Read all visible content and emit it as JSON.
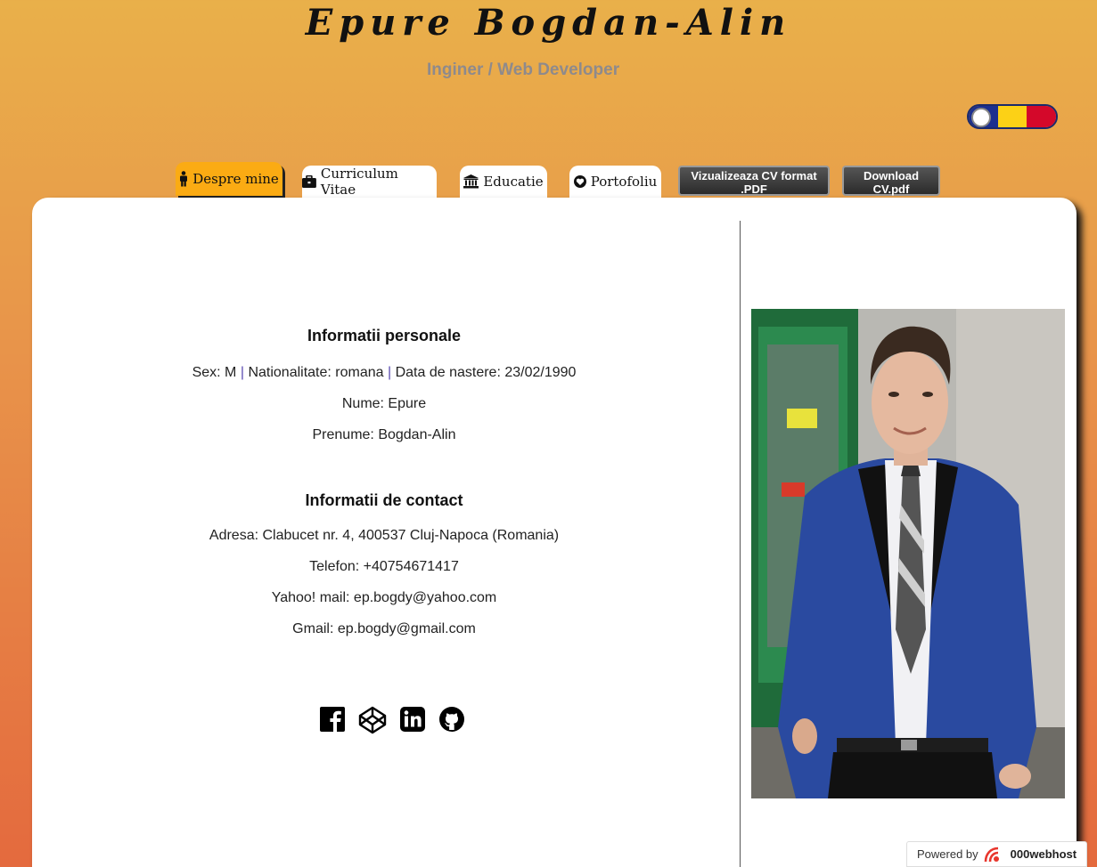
{
  "header": {
    "name": "Epure Bogdan-Alin",
    "subtitle": "Inginer / Web Developer"
  },
  "language_toggle": {
    "colors": [
      "#1c2f8f",
      "#fcd116",
      "#d4082a"
    ]
  },
  "tabs": [
    {
      "label": "Despre mine",
      "icon": "male-icon",
      "active": true
    },
    {
      "label": "Curriculum Vitae",
      "icon": "briefcase-icon",
      "active": false
    },
    {
      "label": "Educatie",
      "icon": "institution-icon",
      "active": false
    },
    {
      "label": "Portofoliu",
      "icon": "heart-icon",
      "active": false
    }
  ],
  "buttons": {
    "view_pdf": "Vizualizeaza CV format .PDF",
    "download": "Download CV.pdf"
  },
  "personal": {
    "heading": "Informatii personale",
    "sex": "Sex: M",
    "nationality": "Nationalitate: romana",
    "birthdate": "Data de nastere: 23/02/1990",
    "separator": "|",
    "last_name": "Nume: Epure",
    "first_name": "Prenume: Bogdan-Alin"
  },
  "contact": {
    "heading": "Informatii de contact",
    "address": "Adresa: Clabucet nr. 4, 400537 Cluj-Napoca (Romania)",
    "phone": "Telefon: +40754671417",
    "yahoo": "Yahoo! mail: ep.bogdy@yahoo.com",
    "gmail": "Gmail: ep.bogdy@gmail.com"
  },
  "social_icons": [
    "facebook-icon",
    "codepen-icon",
    "linkedin-icon",
    "github-icon"
  ],
  "footer_badge": {
    "prefix": "Powered by",
    "brand": "000webhost"
  }
}
